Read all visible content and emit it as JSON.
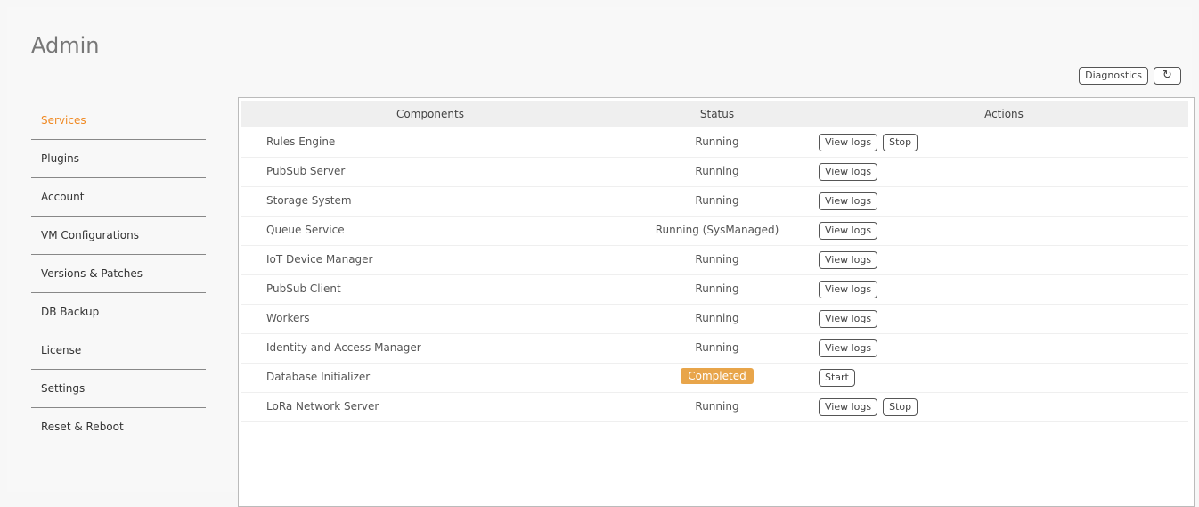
{
  "page": {
    "title": "Admin"
  },
  "toolbar": {
    "diagnostics_label": "Diagnostics",
    "refresh_icon": "refresh-icon"
  },
  "sidebar": {
    "items": [
      {
        "label": "Services"
      },
      {
        "label": "Plugins"
      },
      {
        "label": "Account"
      },
      {
        "label": "VM Configurations"
      },
      {
        "label": "Versions & Patches"
      },
      {
        "label": "DB Backup"
      },
      {
        "label": "License"
      },
      {
        "label": "Settings"
      },
      {
        "label": "Reset & Reboot"
      }
    ]
  },
  "table": {
    "headers": {
      "components": "Components",
      "status": "Status",
      "actions": "Actions"
    },
    "rows": [
      {
        "name": "Rules Engine",
        "status": "Running",
        "actions": [
          "View logs",
          "Stop"
        ]
      },
      {
        "name": "PubSub Server",
        "status": "Running",
        "actions": [
          "View logs"
        ]
      },
      {
        "name": "Storage System",
        "status": "Running",
        "actions": [
          "View logs"
        ]
      },
      {
        "name": "Queue Service",
        "status": "Running (SysManaged)",
        "actions": [
          "View logs"
        ]
      },
      {
        "name": "IoT Device Manager",
        "status": "Running",
        "actions": [
          "View logs"
        ]
      },
      {
        "name": "PubSub Client",
        "status": "Running",
        "actions": [
          "View logs"
        ]
      },
      {
        "name": "Workers",
        "status": "Running",
        "actions": [
          "View logs"
        ]
      },
      {
        "name": "Identity and Access Manager",
        "status": "Running",
        "actions": [
          "View logs"
        ]
      },
      {
        "name": "Database Initializer",
        "status": "Completed",
        "actions": [
          "Start"
        ]
      },
      {
        "name": "LoRa Network Server",
        "status": "Running",
        "actions": [
          "View logs",
          "Stop"
        ]
      }
    ]
  },
  "colors": {
    "accent": "#f08a24",
    "badge": "#e8a54a"
  }
}
